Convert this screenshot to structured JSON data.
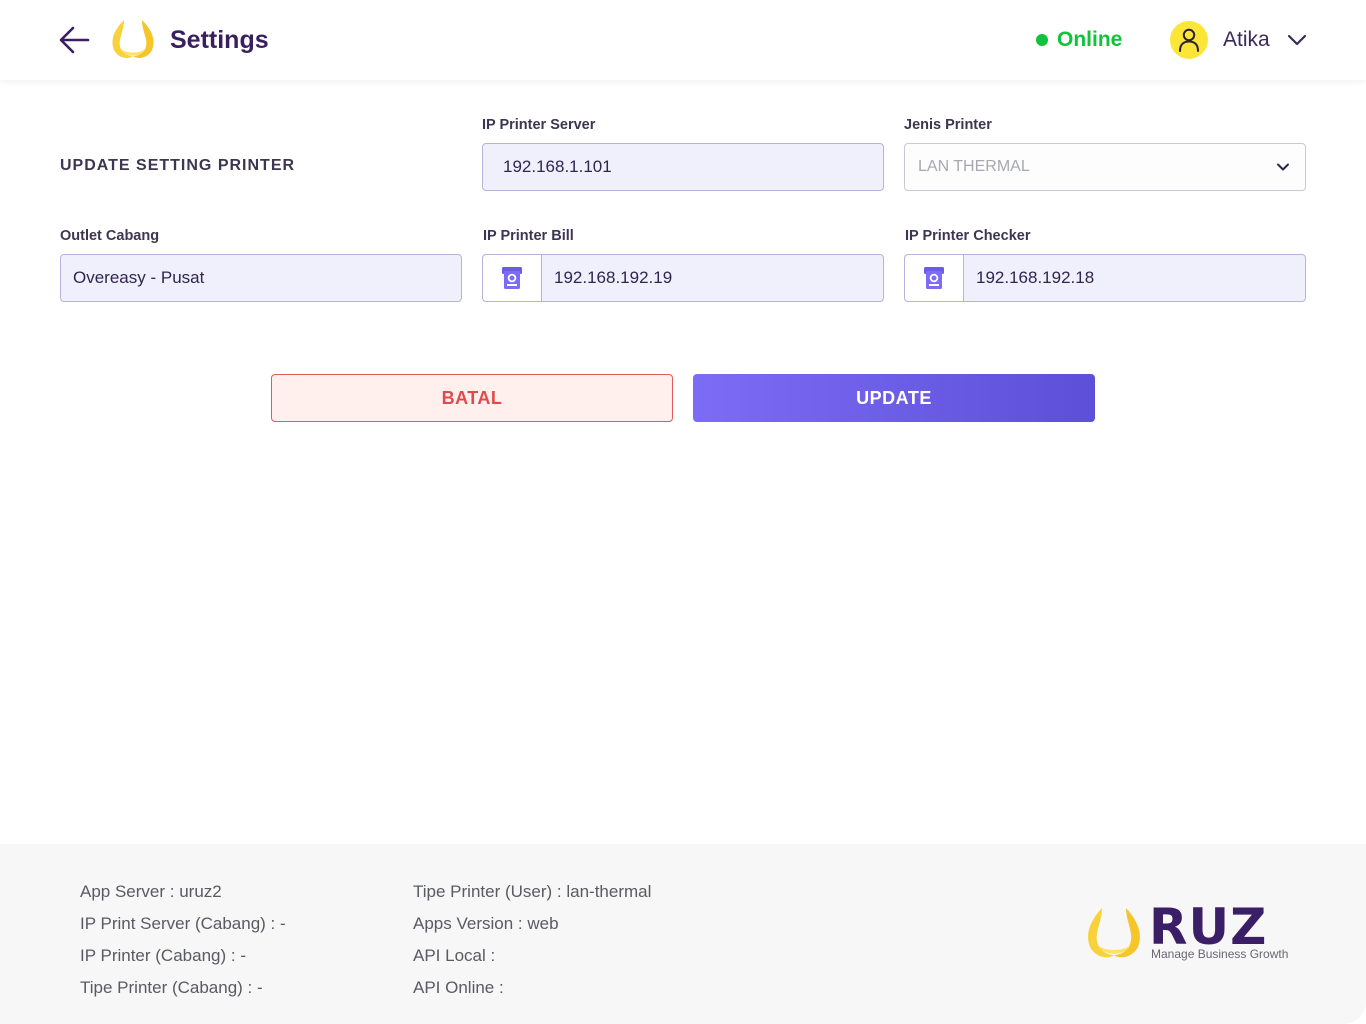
{
  "header": {
    "title": "Settings",
    "status": "Online",
    "user_name": "Atika",
    "colors": {
      "status": "#12c23a",
      "title": "#3a1f5f",
      "avatar": "#fbe536"
    }
  },
  "form": {
    "section_title": "UPDATE SETTING PRINTER",
    "ip_printer_server": {
      "label": "IP Printer Server",
      "value": "192.168.1.101"
    },
    "jenis_printer": {
      "label": "Jenis Printer",
      "value": "LAN THERMAL"
    },
    "outlet_cabang": {
      "label": "Outlet Cabang",
      "value": "Overeasy - Pusat"
    },
    "ip_printer_bill": {
      "label": "IP Printer Bill",
      "value": "192.168.192.19",
      "icon": "printer-icon"
    },
    "ip_printer_checker": {
      "label": "IP Printer Checker",
      "value": "192.168.192.18",
      "icon": "printer-icon"
    }
  },
  "actions": {
    "cancel_label": "BATAL",
    "update_label": "UPDATE",
    "colors": {
      "cancel": "#e14a4a",
      "update": "#6b5ce8"
    }
  },
  "footer": {
    "left": [
      "App Server : uruz2",
      "IP Print Server (Cabang) : -",
      "IP Printer (Cabang) : -",
      "Tipe Printer (Cabang) : -"
    ],
    "right": [
      "Tipe Printer (User) : lan-thermal",
      "Apps Version : web",
      "API Local :",
      "API Online :"
    ],
    "brand_name": "RUZ",
    "brand_tagline": "Manage Business Growth"
  }
}
